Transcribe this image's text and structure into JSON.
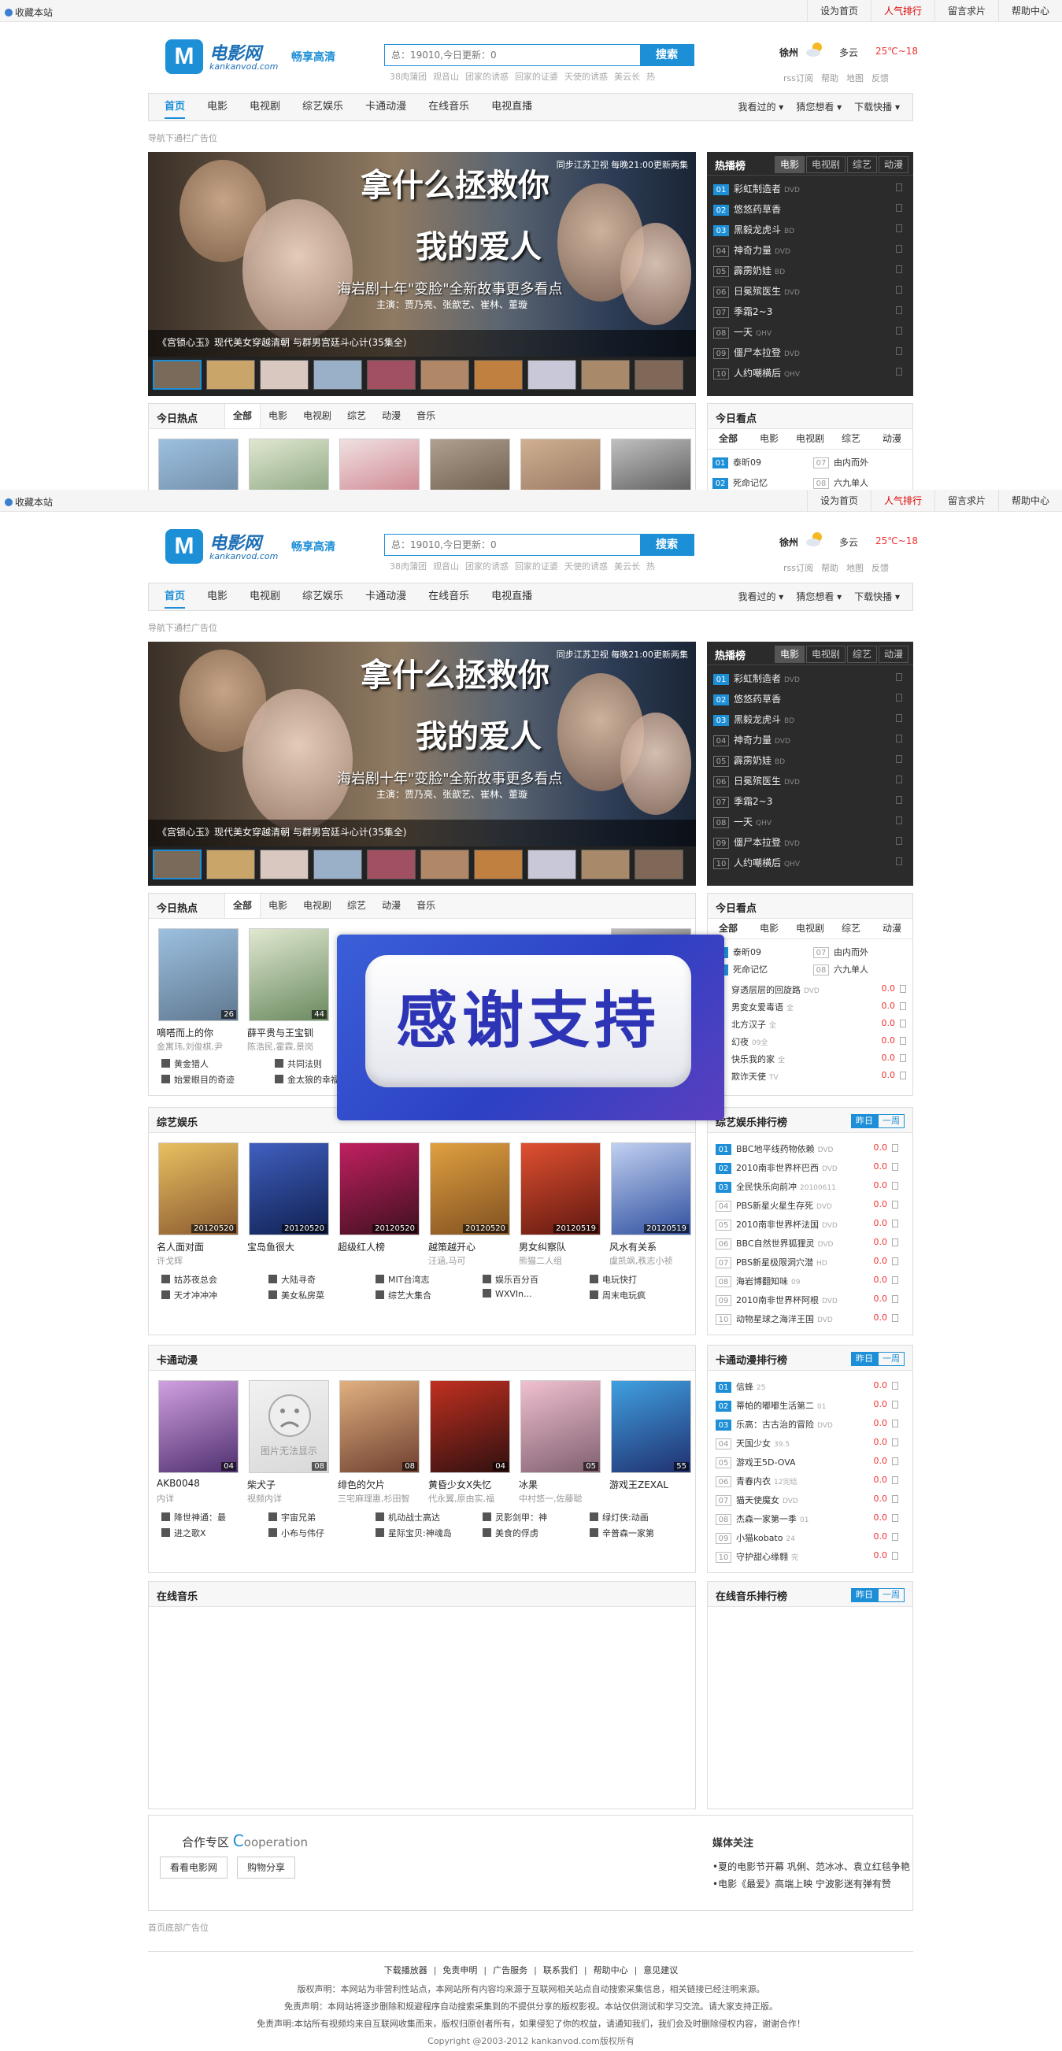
{
  "topbar": {
    "favorite": "收藏本站",
    "links": [
      "设为首页",
      "人气排行",
      "留言求片",
      "帮助中心"
    ]
  },
  "logo": {
    "mark": "M",
    "cn": "电影网",
    "en": "kankanvod.com"
  },
  "slogan": "畅享高清",
  "search": {
    "placeholder": "总：19010,今日更新：0",
    "button": "搜索",
    "hot": [
      "38肉蒲团",
      "观音山",
      "团家的诱惑",
      "回家的证婆",
      "天使的诱惑",
      "美云长",
      "热"
    ]
  },
  "weather": {
    "city": "徐州",
    "cond": "多云",
    "temp": "25℃~18",
    "links": [
      "rss订阅",
      "帮助",
      "地图",
      "反馈"
    ]
  },
  "nav": {
    "items": [
      "首页",
      "电影",
      "电视剧",
      "综艺娱乐",
      "卡通动漫",
      "在线音乐",
      "电视直播"
    ],
    "right": [
      "我看过的 ▾",
      "猜您想看 ▾",
      "下载快播 ▾"
    ]
  },
  "ad_top": "导航下通栏广告位",
  "banner": {
    "tv": "同步江苏卫视    每晚21:00更新两集",
    "title1": "拿什么拯救你",
    "title2": "我的爱人",
    "sub": "海岩剧十年\"变脸\"全新故事更多看点",
    "cast": "主演：贾乃亮、张歆艺、崔林、董璇",
    "caption": "《宫锁心玉》现代美女穿越清朝 与群男宫廷斗心计(35集全)"
  },
  "hot": {
    "title": "热播榜",
    "tabs": [
      "电影",
      "电视剧",
      "综艺",
      "动漫"
    ],
    "rows": [
      {
        "n": "01",
        "name": "彩虹制造者",
        "q": "DVD"
      },
      {
        "n": "02",
        "name": "悠悠药草香",
        "q": ""
      },
      {
        "n": "03",
        "name": "黑毅龙虎斗",
        "q": "BD"
      },
      {
        "n": "04",
        "name": "神奇力量",
        "q": "DVD"
      },
      {
        "n": "05",
        "name": "霹雳奶娃",
        "q": "BD"
      },
      {
        "n": "06",
        "name": "日冕殡医生",
        "q": "DVD"
      },
      {
        "n": "07",
        "name": "季霜2~3",
        "q": ""
      },
      {
        "n": "08",
        "name": "一天",
        "q": "QHV"
      },
      {
        "n": "09",
        "name": "僵尸本拉登",
        "q": "DVD"
      },
      {
        "n": "10",
        "name": "人约嘲横后",
        "q": "QHV"
      }
    ]
  },
  "today_hot": {
    "title": "今日热点",
    "tabs": [
      "全部",
      "电影",
      "电视剧",
      "综艺",
      "动漫",
      "音乐"
    ],
    "items": [
      {
        "title": "嘀嗒而上的你",
        "desc": "金寓玮,刘俊棋,尹",
        "date": "26"
      },
      {
        "title": "薛平贵与王宝钏",
        "desc": "陈浩民,霍霖,景岗",
        "date": "44"
      }
    ],
    "bullets": [
      "黄金猎人",
      "共同法则",
      "始爱眼目的奇迹",
      "金太狼的幸福"
    ]
  },
  "today_look": {
    "title": "今日看点",
    "tabs": [
      "全部",
      "电影",
      "电视剧",
      "综艺",
      "动漫"
    ],
    "rows": [
      {
        "n": "01",
        "name": "泰昕09"
      },
      {
        "n": "07",
        "name": "由内而外"
      },
      {
        "n": "02",
        "name": "死命记忆"
      },
      {
        "n": "08",
        "name": "六九单人"
      }
    ],
    "list": [
      {
        "name": "穿透层层的回旋路",
        "q": "DVD",
        "s": "0.0"
      },
      {
        "name": "男变女爱毒语",
        "q": "全",
        "s": "0.0"
      },
      {
        "name": "北方汉子",
        "q": "全",
        "s": "0.0"
      },
      {
        "name": "幻夜",
        "q": "09全",
        "s": "0.0"
      },
      {
        "name": "快乐我的家",
        "q": "全",
        "s": "0.0"
      },
      {
        "name": "欺诈天使",
        "q": "TV",
        "s": "0.0"
      }
    ]
  },
  "variety": {
    "title": "综艺娱乐",
    "items": [
      {
        "title": "名人面对面",
        "desc": "许戈辉",
        "date": "20120520"
      },
      {
        "title": "宝岛鱼很大",
        "desc": "",
        "date": "20120520"
      },
      {
        "title": "超级红人榜",
        "desc": "",
        "date": "20120520"
      },
      {
        "title": "越策越开心",
        "desc": "汪涵,马可",
        "date": "20120520"
      },
      {
        "title": "男女纠察队",
        "desc": "熊猫二人组",
        "date": "20120519"
      },
      {
        "title": "风水有关系",
        "desc": "虞凯飒,秩志小祯",
        "date": "20120519"
      }
    ],
    "bullets": [
      "姑苏夜总会",
      "大陆寻奇",
      "MIT台湾志",
      "娱乐百分百",
      "电玩快打",
      "天才冲冲冲",
      "美女私房菜",
      "综艺大集合",
      "WXVIn...",
      "周末电玩疯"
    ]
  },
  "variety_rank": {
    "title": "综艺娱乐排行榜",
    "toggle": [
      "昨日",
      "一周"
    ],
    "rows": [
      {
        "n": "01",
        "name": "BBC地平线药物依赖",
        "q": "DVD",
        "s": "0.0"
      },
      {
        "n": "02",
        "name": "2010南非世界杯巴西",
        "q": "DVD",
        "s": "0.0"
      },
      {
        "n": "03",
        "name": "全民快乐向前冲",
        "q": "20100611",
        "s": "0.0"
      },
      {
        "n": "04",
        "name": "PBS新星火星生存死",
        "q": "DVD",
        "s": "0.0"
      },
      {
        "n": "05",
        "name": "2010南非世界杯法国",
        "q": "DVD",
        "s": "0.0"
      },
      {
        "n": "06",
        "name": "BBC自然世界狐狸灵",
        "q": "DVD",
        "s": "0.0"
      },
      {
        "n": "07",
        "name": "PBS新星极限洞穴潜",
        "q": "HD",
        "s": "0.0"
      },
      {
        "n": "08",
        "name": "海岩博翻知味",
        "q": "09",
        "s": "0.0"
      },
      {
        "n": "09",
        "name": "2010南非世界杯阿根",
        "q": "DVD",
        "s": "0.0"
      },
      {
        "n": "10",
        "name": "动物星球之海洋王国",
        "q": "DVD",
        "s": "0.0"
      }
    ]
  },
  "anime": {
    "title": "卡通动漫",
    "items": [
      {
        "title": "AKB0048",
        "desc": "内详",
        "date": "04"
      },
      {
        "title": "柴犬子",
        "desc": "视频内详",
        "date": "08"
      },
      {
        "title": "绯色的欠片",
        "desc": "三宅麻理惠,杉田智",
        "date": "08"
      },
      {
        "title": "黄昏少女X失忆",
        "desc": "代永翼,原由实,福",
        "date": "04"
      },
      {
        "title": "冰果",
        "desc": "中村悠一,佐藤聪",
        "date": "05"
      },
      {
        "title": "游戏王ZEXAL",
        "desc": "",
        "date": "55"
      }
    ],
    "noimg": "图片无法显示",
    "bullets": [
      "降世神通：最",
      "宇宙兄弟",
      "机动战士高达",
      "灵影剑甲：神",
      "绿灯侠:动画",
      "进之歌X",
      "小布与伟仔",
      "星际宝贝:神魂岛",
      "美食的俘虏",
      "辛普森一家第"
    ]
  },
  "anime_rank": {
    "title": "卡通动漫排行榜",
    "toggle": [
      "昨日",
      "一周"
    ],
    "rows": [
      {
        "n": "01",
        "name": "信蜂",
        "q": "25",
        "s": "0.0"
      },
      {
        "n": "02",
        "name": "蒂帕的嘟嘟生活第二",
        "q": "01",
        "s": "0.0"
      },
      {
        "n": "03",
        "name": "乐高：古古治的冒险",
        "q": "DVD",
        "s": "0.0"
      },
      {
        "n": "04",
        "name": "天国少女",
        "q": "39.5",
        "s": "0.0"
      },
      {
        "n": "05",
        "name": "游戏王5D-OVA",
        "q": "",
        "s": "0.0"
      },
      {
        "n": "06",
        "name": "青春内衣",
        "q": "12完结",
        "s": "0.0"
      },
      {
        "n": "07",
        "name": "猫天使魔女",
        "q": "DVD",
        "s": "0.0"
      },
      {
        "n": "08",
        "name": "杰森一家第一季",
        "q": "01",
        "s": "0.0"
      },
      {
        "n": "09",
        "name": "小猫kobato",
        "q": "24",
        "s": "0.0"
      },
      {
        "n": "10",
        "name": "守护甜心缘翱",
        "q": "完",
        "s": "0.0"
      }
    ]
  },
  "music": {
    "title": "在线音乐"
  },
  "music_rank": {
    "title": "在线音乐排行榜",
    "toggle": [
      "昨日",
      "一周"
    ]
  },
  "coop": {
    "title_cn": "合作专区",
    "title_c": "C",
    "title_en": "ooperation",
    "buttons": [
      "看看电影网",
      "购物分享"
    ],
    "media_title": "媒体关注",
    "media": [
      "•夏的电影节开幕 巩俐、范冰冰、袁立红毯争艳",
      "•电影《最爱》高端上映 宁波影迷有弹有赞"
    ]
  },
  "ad_bottom": "首页底部广告位",
  "footer": {
    "links": [
      "下载播放器",
      "免责申明",
      "广告服务",
      "联系我们",
      "帮助中心",
      "意见建议"
    ],
    "lines": [
      "版权声明：本网站为非营利性站点，本网站所有内容均来源于互联网相关站点自动搜索采集信息，相关链接已经注明来源。",
      "免责声明：本网站将逐步删除和规避程序自动搜索采集到的不提供分享的版权影视。本站仅供测试和学习交流。请大家支持正版。",
      "免责声明:本站所有视频均来自互联网收集而来，版权归原创者所有，如果侵犯了你的权益，请通知我们，我们会及时删除侵权内容，谢谢合作！",
      "Copyright @2003-2012 kankanvod.com版权所有"
    ]
  },
  "thanks": "感谢支持"
}
